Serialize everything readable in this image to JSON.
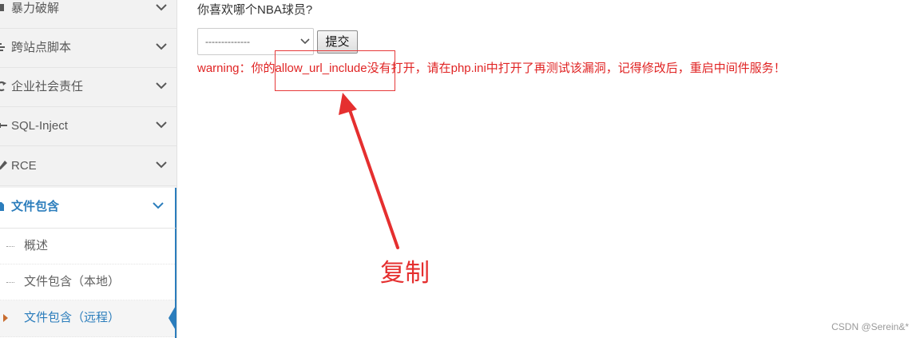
{
  "sidebar": {
    "items": [
      {
        "label": "暴力破解",
        "icon": "shield-icon"
      },
      {
        "label": "跨站点脚本",
        "icon": "list-icon"
      },
      {
        "label": "企业社会责任",
        "icon": "refresh-icon"
      },
      {
        "label": "SQL-Inject",
        "icon": "key-icon"
      },
      {
        "label": "RCE",
        "icon": "pencil-icon"
      },
      {
        "label": "文件包含",
        "icon": "file-icon",
        "active": true
      }
    ],
    "submenu": [
      {
        "label": "概述"
      },
      {
        "label": "文件包含（本地）"
      },
      {
        "label": "文件包含（远程）",
        "current": true
      }
    ]
  },
  "main": {
    "question": "你喜欢哪个NBA球员?",
    "select_value": "--------------",
    "submit_label": "提交",
    "warning": "warning：你的allow_url_include没有打开，请在php.ini中打开了再测试该漏洞，记得修改后，重启中间件服务！"
  },
  "annotation": {
    "label": "复制",
    "color": "#e52f2f"
  },
  "watermark": "CSDN @Serein&*",
  "colors": {
    "accent": "#2b7dbc",
    "warning": "#e02424",
    "sidebar_bg": "#f2f2f2"
  }
}
